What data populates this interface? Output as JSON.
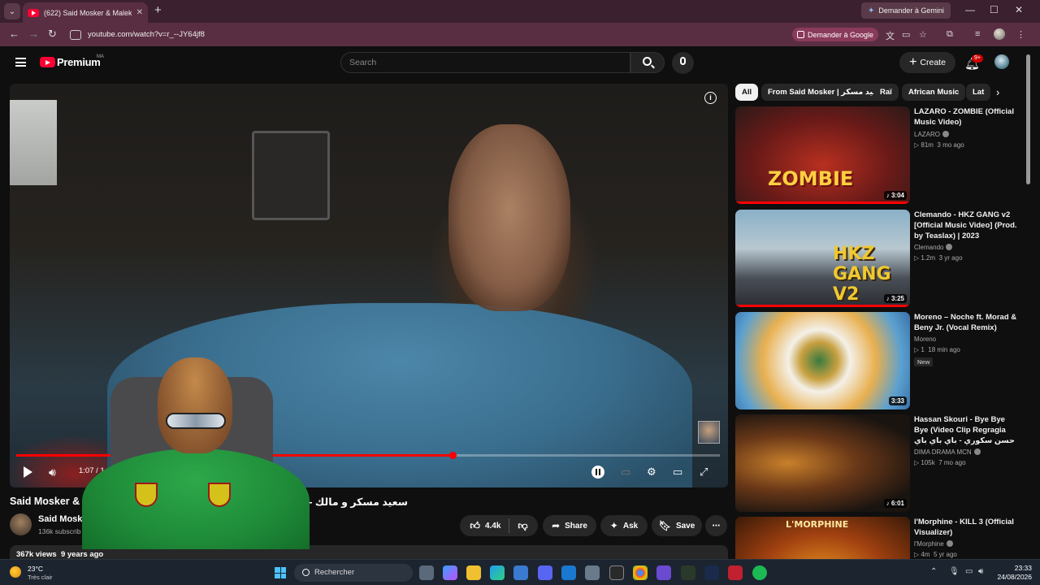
{
  "browser": {
    "tab_title": "(622) Said Mosker & Malek - H",
    "tab_list": "⌄",
    "tab_close": "✕",
    "new_tab": "+",
    "gemini_label": "Demander à Gemini",
    "url": "youtube.com/watch?v=r_--JY64jf8",
    "ask_google": "Demander à Google",
    "minimize": "—",
    "maximize": "☐",
    "close": "✕",
    "back": "←",
    "forward": "→",
    "reload": "↻",
    "bookmark": "☆",
    "extensions": "⧉",
    "menu": "⋮"
  },
  "youtube": {
    "brand": "Premium",
    "region": "MA",
    "search_placeholder": "Search",
    "create_label": "Create",
    "notif_count": "9+"
  },
  "player": {
    "time": "1:07 / 1",
    "progress_fraction": 0.62
  },
  "video": {
    "title_left": "Said Mosker & M",
    "title_right": "سعيد مسكر و مالك - هي مشات",
    "channel": "Said Mosker",
    "subscribers": "136k subscrib",
    "likes": "4.4k",
    "share": "Share",
    "ask": "Ask",
    "save": "Save",
    "views": "367k views",
    "age": "9 years ago"
  },
  "chips": [
    "All",
    "From Said Mosker | سعيد مسكر",
    "Raï",
    "African Music",
    "Lat"
  ],
  "recommendations": [
    {
      "title": "LAZARO - ZOMBIE (Official Music Video)",
      "channel": "LAZARO",
      "views": "81m",
      "age": "3 mo ago",
      "duration": "3:04",
      "thumb_text": "ZOMBIE",
      "watched": 1.0
    },
    {
      "title": "Clemando - HKZ GANG v2 [Official Music Video] (Prod. by Teaslax) | 2023",
      "channel": "Clemando",
      "views": "1.2m",
      "age": "3 yr ago",
      "duration": "3:25",
      "thumb_text": "HKZ GANG V2",
      "watched": 1.0
    },
    {
      "title": "Moreno – Noche ft. Morad & Beny Jr. (Vocal Remix)",
      "channel": "Moreno",
      "views": "1",
      "age": "18 min ago",
      "duration": "3:33",
      "badge": "New",
      "watched": 0
    },
    {
      "title": "Hassan Skouri - Bye Bye Bye (Video Clip Regragia حسن سكوري - باي باي باي (فيديو كليب ...",
      "channel": "DIMA DRAMA MCN",
      "views": "105k",
      "age": "7 mo ago",
      "duration": "6:01",
      "watched": 0
    },
    {
      "title": "l'Morphine - KILL 3 (Official Visualizer)",
      "channel": "l'Morphine",
      "views": "4m",
      "age": "5 yr ago",
      "duration": "",
      "thumb_text": "L'MORPHINE",
      "watched": 0
    }
  ],
  "taskbar": {
    "temperature": "23°C",
    "weather": "Très clair",
    "search": "Rechercher",
    "time": "23:33",
    "date": "24/08/2026"
  }
}
